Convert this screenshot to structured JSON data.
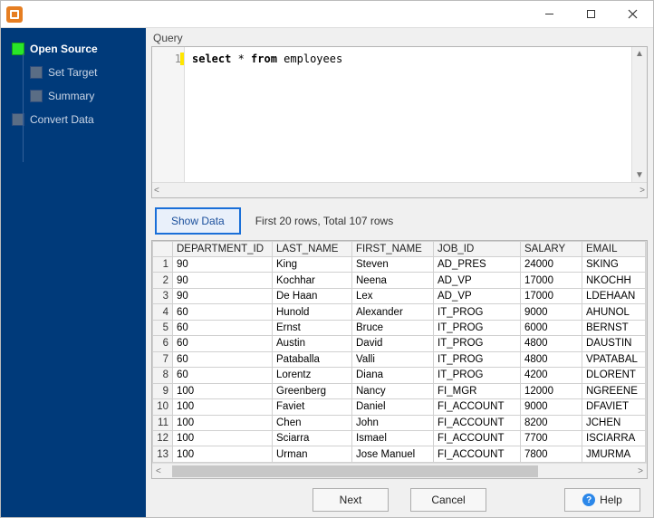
{
  "window": {
    "title": ""
  },
  "sidebar": {
    "items": [
      {
        "label": "Open Source",
        "active": true
      },
      {
        "label": "Set Target",
        "active": false
      },
      {
        "label": "Summary",
        "active": false
      },
      {
        "label": "Convert Data",
        "active": false
      }
    ]
  },
  "query": {
    "section_label": "Query",
    "line_number": "1",
    "sql_parts": {
      "select": "select",
      "star_from": " * ",
      "from": "from",
      "table": " employees"
    }
  },
  "controls": {
    "show_data_label": "Show Data",
    "status_text": "First 20 rows, Total 107 rows"
  },
  "grid": {
    "columns": [
      "DEPARTMENT_ID",
      "LAST_NAME",
      "FIRST_NAME",
      "JOB_ID",
      "SALARY",
      "EMAIL"
    ],
    "rows": [
      {
        "n": "1",
        "DEPARTMENT_ID": "90",
        "LAST_NAME": "King",
        "FIRST_NAME": "Steven",
        "JOB_ID": "AD_PRES",
        "SALARY": "24000",
        "EMAIL": "SKING"
      },
      {
        "n": "2",
        "DEPARTMENT_ID": "90",
        "LAST_NAME": "Kochhar",
        "FIRST_NAME": "Neena",
        "JOB_ID": "AD_VP",
        "SALARY": "17000",
        "EMAIL": "NKOCHH"
      },
      {
        "n": "3",
        "DEPARTMENT_ID": "90",
        "LAST_NAME": "De Haan",
        "FIRST_NAME": "Lex",
        "JOB_ID": "AD_VP",
        "SALARY": "17000",
        "EMAIL": "LDEHAAN"
      },
      {
        "n": "4",
        "DEPARTMENT_ID": "60",
        "LAST_NAME": "Hunold",
        "FIRST_NAME": "Alexander",
        "JOB_ID": "IT_PROG",
        "SALARY": "9000",
        "EMAIL": "AHUNOL"
      },
      {
        "n": "5",
        "DEPARTMENT_ID": "60",
        "LAST_NAME": "Ernst",
        "FIRST_NAME": "Bruce",
        "JOB_ID": "IT_PROG",
        "SALARY": "6000",
        "EMAIL": "BERNST"
      },
      {
        "n": "6",
        "DEPARTMENT_ID": "60",
        "LAST_NAME": "Austin",
        "FIRST_NAME": "David",
        "JOB_ID": "IT_PROG",
        "SALARY": "4800",
        "EMAIL": "DAUSTIN"
      },
      {
        "n": "7",
        "DEPARTMENT_ID": "60",
        "LAST_NAME": "Pataballa",
        "FIRST_NAME": "Valli",
        "JOB_ID": "IT_PROG",
        "SALARY": "4800",
        "EMAIL": "VPATABAL"
      },
      {
        "n": "8",
        "DEPARTMENT_ID": "60",
        "LAST_NAME": "Lorentz",
        "FIRST_NAME": "Diana",
        "JOB_ID": "IT_PROG",
        "SALARY": "4200",
        "EMAIL": "DLORENT"
      },
      {
        "n": "9",
        "DEPARTMENT_ID": "100",
        "LAST_NAME": "Greenberg",
        "FIRST_NAME": "Nancy",
        "JOB_ID": "FI_MGR",
        "SALARY": "12000",
        "EMAIL": "NGREENE"
      },
      {
        "n": "10",
        "DEPARTMENT_ID": "100",
        "LAST_NAME": "Faviet",
        "FIRST_NAME": "Daniel",
        "JOB_ID": "FI_ACCOUNT",
        "SALARY": "9000",
        "EMAIL": "DFAVIET"
      },
      {
        "n": "11",
        "DEPARTMENT_ID": "100",
        "LAST_NAME": "Chen",
        "FIRST_NAME": "John",
        "JOB_ID": "FI_ACCOUNT",
        "SALARY": "8200",
        "EMAIL": "JCHEN"
      },
      {
        "n": "12",
        "DEPARTMENT_ID": "100",
        "LAST_NAME": "Sciarra",
        "FIRST_NAME": "Ismael",
        "JOB_ID": "FI_ACCOUNT",
        "SALARY": "7700",
        "EMAIL": "ISCIARRA"
      },
      {
        "n": "13",
        "DEPARTMENT_ID": "100",
        "LAST_NAME": "Urman",
        "FIRST_NAME": "Jose Manuel",
        "JOB_ID": "FI_ACCOUNT",
        "SALARY": "7800",
        "EMAIL": "JMURMA"
      }
    ]
  },
  "footer": {
    "next_label": "Next",
    "cancel_label": "Cancel",
    "help_label": "Help"
  }
}
